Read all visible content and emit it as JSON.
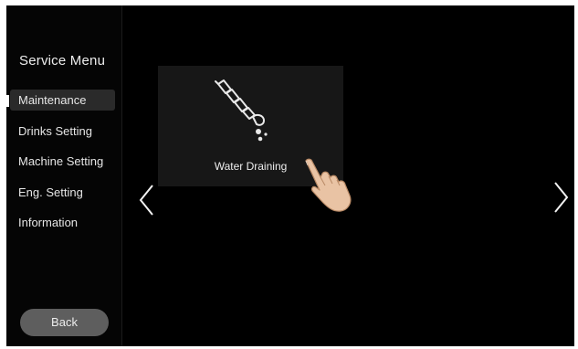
{
  "sidebar": {
    "title": "Service Menu",
    "items": [
      {
        "label": "Maintenance",
        "active": true
      },
      {
        "label": "Drinks Setting",
        "active": false
      },
      {
        "label": "Machine Setting",
        "active": false
      },
      {
        "label": "Eng. Setting",
        "active": false
      },
      {
        "label": "Information",
        "active": false
      }
    ],
    "back_label": "Back"
  },
  "main": {
    "tiles": [
      {
        "label": "Water Draining",
        "icon": "water-drain-icon"
      }
    ],
    "prev_icon": "chevron-left-icon",
    "next_icon": "chevron-right-icon"
  },
  "colors": {
    "screen_background": "#000000",
    "tile_background": "#171717",
    "active_item_background": "#2a2a2a",
    "back_button_background": "#5e5e5e",
    "text": "#ededed"
  }
}
